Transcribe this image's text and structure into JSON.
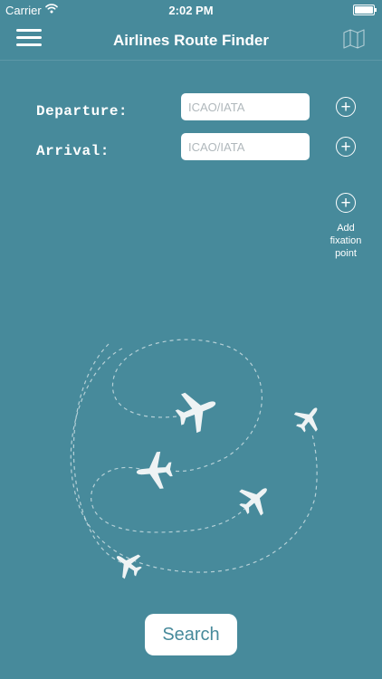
{
  "status_bar": {
    "carrier": "Carrier",
    "time": "2:02 PM"
  },
  "header": {
    "title": "Airlines Route Finder",
    "menu_icon": "hamburger-menu-icon",
    "map_icon": "map-icon"
  },
  "form": {
    "departure": {
      "label": "Departure:",
      "placeholder": "ICAO/IATA",
      "value": ""
    },
    "arrival": {
      "label": "Arrival:",
      "placeholder": "ICAO/IATA",
      "value": ""
    },
    "add_fixation": {
      "label_line1": "Add",
      "label_line2": "fixation",
      "label_line3": "point"
    }
  },
  "search_button": {
    "label": "Search"
  },
  "colors": {
    "background": "#478a9b",
    "foreground": "#ffffff",
    "button_text": "#478a9b"
  }
}
